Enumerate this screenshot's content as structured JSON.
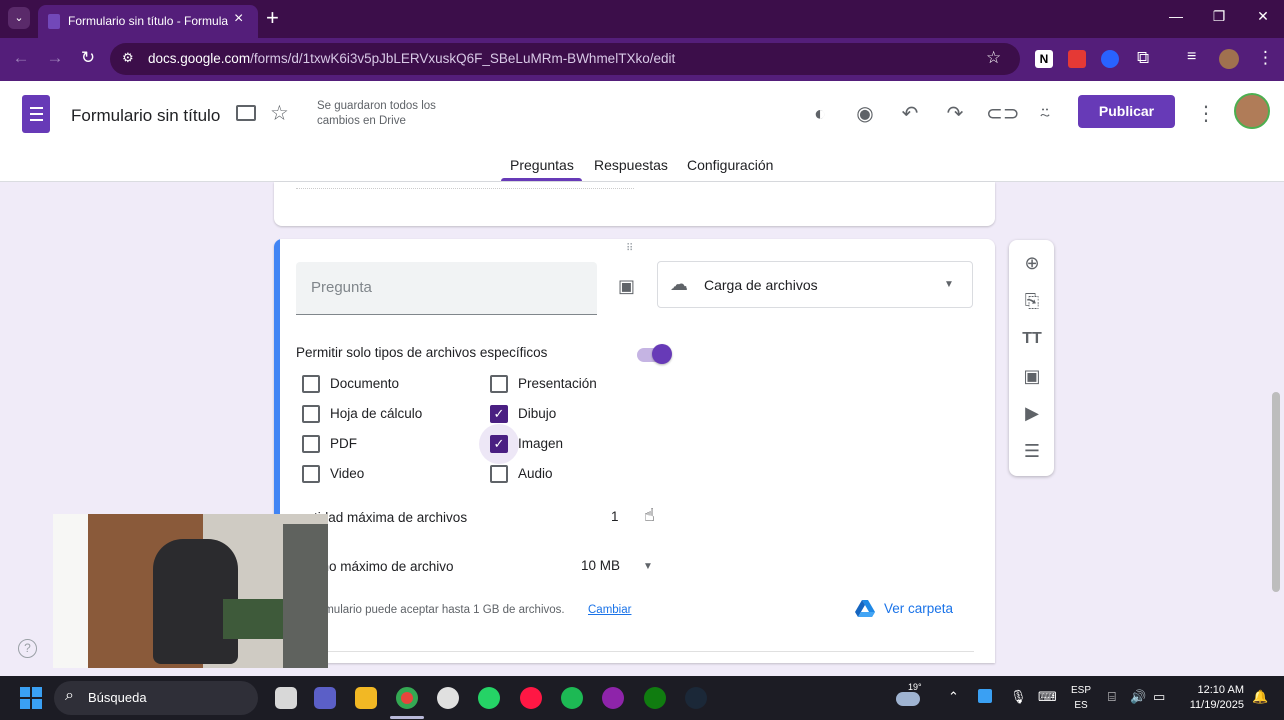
{
  "browser": {
    "tab_title": "Formulario sin título - Formular",
    "url_domain": "docs.google.com",
    "url_path": "/forms/d/1txwK6i3v5pJbLERVxuskQ6F_SBeLuMRm-BWhmelTXko/edit",
    "accent_color": "#541e7a"
  },
  "header": {
    "title": "Formulario sin título",
    "saved_status": "Se guardaron todos los cambios en Drive",
    "publish_label": "Publicar",
    "icons": [
      "palette-icon",
      "preview-eye-icon",
      "undo-icon",
      "redo-icon",
      "link-icon",
      "add-collaborator-icon",
      "more-vert-icon"
    ]
  },
  "tabs": [
    {
      "label": "Preguntas",
      "active": true
    },
    {
      "label": "Respuestas",
      "active": false
    },
    {
      "label": "Configuración",
      "active": false
    }
  ],
  "question": {
    "placeholder": "Pregunta",
    "type": "Carga de archivos",
    "restrict_label": "Permitir solo tipos de archivos específicos",
    "restrict_enabled": true,
    "file_types": [
      {
        "label": "Documento",
        "checked": false
      },
      {
        "label": "Presentación",
        "checked": false
      },
      {
        "label": "Hoja de cálculo",
        "checked": false
      },
      {
        "label": "Dibujo",
        "checked": true
      },
      {
        "label": "PDF",
        "checked": false
      },
      {
        "label": "Imagen",
        "checked": true
      },
      {
        "label": "Video",
        "checked": false
      },
      {
        "label": "Audio",
        "checked": false
      }
    ],
    "max_files_label": "Cantidad máxima de archivos",
    "max_files_label_visible": "tidad máxima de archivos",
    "max_files_value": "1",
    "max_size_label_visible": "año máximo de archivo",
    "max_size_value": "10 MB",
    "limit_text_visible": "ormulario puede aceptar hasta 1 GB de archivos.",
    "change_link": "Cambiar",
    "view_folder": "Ver carpeta"
  },
  "toolbar": [
    "add-question-icon",
    "import-questions-icon",
    "add-title-icon",
    "add-image-icon",
    "add-video-icon",
    "add-section-icon"
  ],
  "taskbar": {
    "search_label": "Búsqueda",
    "weather_temp": "19°",
    "lang_top": "ESP",
    "lang_bottom": "ES",
    "time": "12:10 AM",
    "date": "11/19/2025"
  }
}
